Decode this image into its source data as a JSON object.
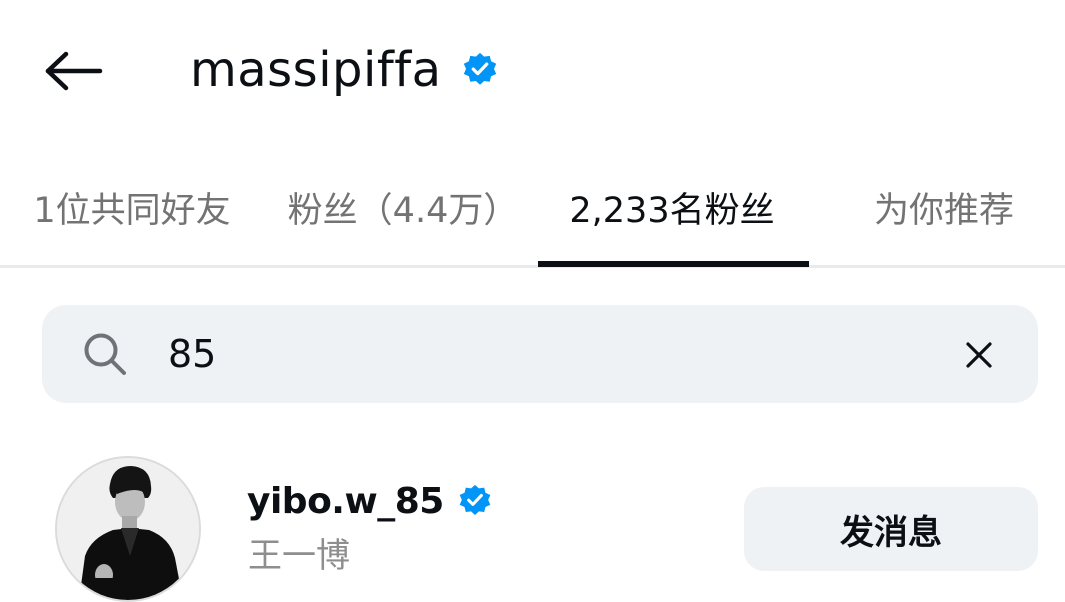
{
  "header": {
    "title": "massipiffa",
    "verified": true,
    "back_icon": "arrow-left-icon",
    "verified_icon": "verified-badge-icon"
  },
  "tabs": [
    {
      "label": "1位共同好友",
      "active": false
    },
    {
      "label": "粉丝（4.4万）",
      "active": false
    },
    {
      "label": "2,233名粉丝",
      "active": true
    },
    {
      "label": "为你推荐",
      "active": false
    }
  ],
  "search": {
    "value": "85",
    "placeholder": "",
    "icon": "search-icon",
    "clear_icon": "close-icon"
  },
  "results": [
    {
      "username": "yibo.w_85",
      "full_name": "王一博",
      "verified": true,
      "action_label": "发消息"
    }
  ],
  "colors": {
    "primary_text": "#0c1014",
    "secondary_text": "#737373",
    "verified_blue": "#0095f6",
    "search_bg": "#eff2f5",
    "button_bg": "#eff2f5",
    "divider": "#e8eaed"
  }
}
